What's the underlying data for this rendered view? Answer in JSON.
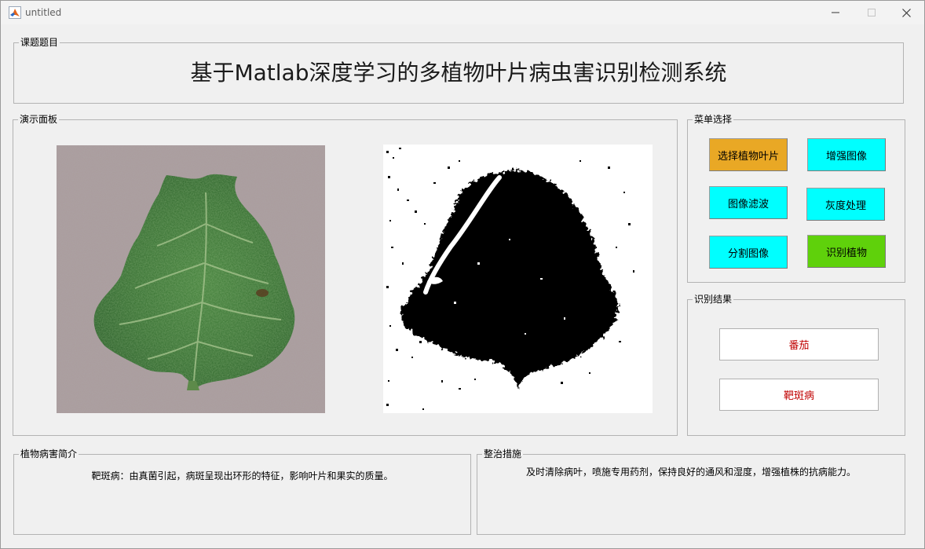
{
  "window": {
    "title": "untitled"
  },
  "title_panel": {
    "label": "课题题目",
    "title": "基于Matlab深度学习的多植物叶片病虫害识别检测系统"
  },
  "demo_panel": {
    "label": "演示面板"
  },
  "menu_panel": {
    "label": "菜单选择",
    "buttons": [
      {
        "label": "选择植物叶片",
        "color": "#e9a825"
      },
      {
        "label": "增强图像",
        "color": "#00ffff"
      },
      {
        "label": "图像滤波",
        "color": "#00ffff"
      },
      {
        "label": "灰度处理",
        "color": "#00ffff"
      },
      {
        "label": "分割图像",
        "color": "#00ffff"
      },
      {
        "label": "识别植物",
        "color": "#5fd10b"
      }
    ]
  },
  "result_panel": {
    "label": "识别结果",
    "plant": "番茄",
    "disease": "靶斑病",
    "text_color": "#c00000"
  },
  "intro_panel": {
    "label": "植物病害简介",
    "text": "靶斑病：由真菌引起，病斑呈现出环形的特征，影响叶片和果实的质量。"
  },
  "treatment_panel": {
    "label": "整治措施",
    "text": "及时清除病叶，喷施专用药剂，保持良好的通风和湿度，增强植株的抗病能力。"
  }
}
